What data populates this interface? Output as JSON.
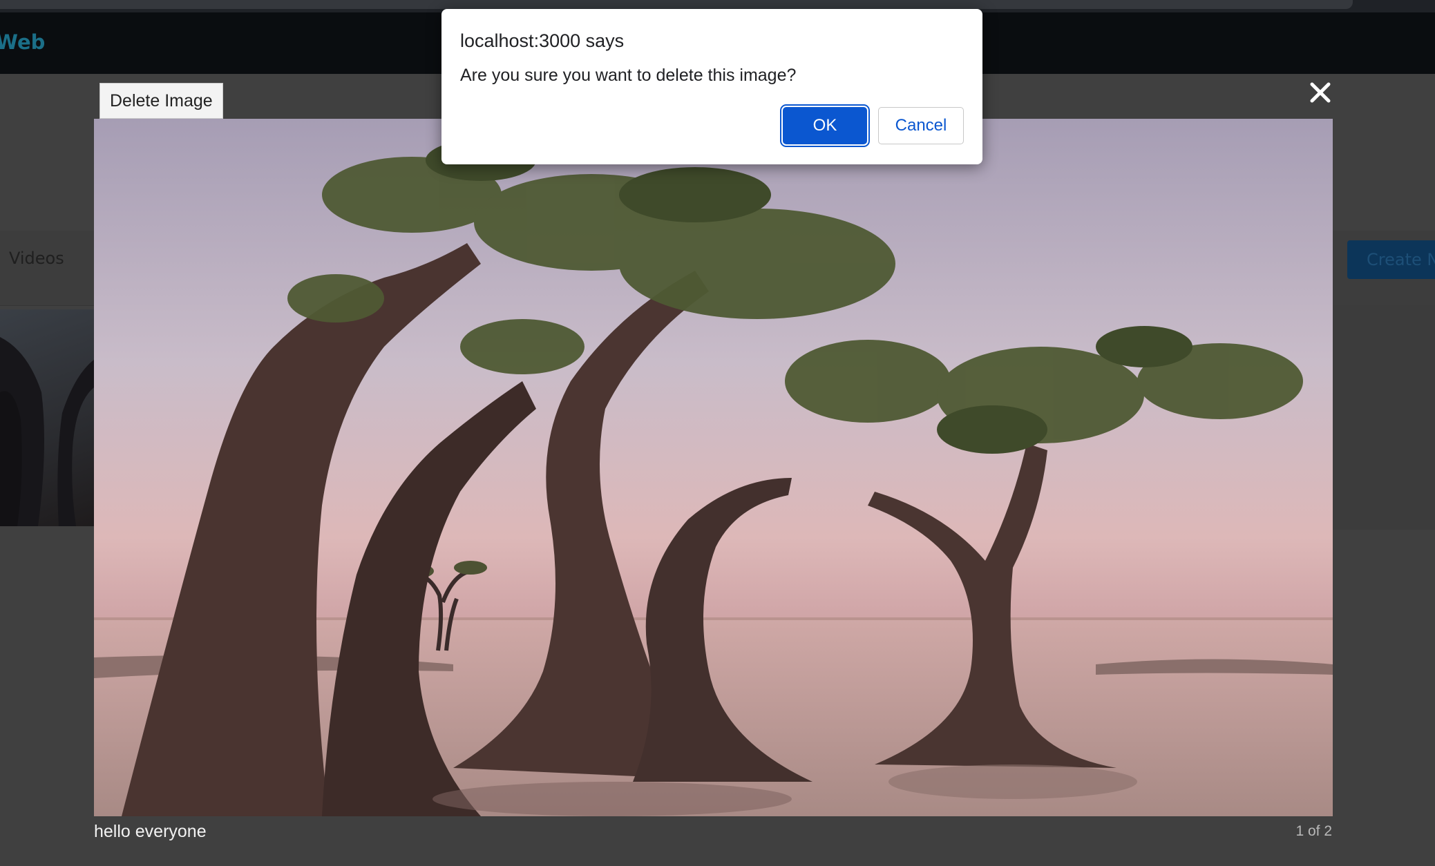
{
  "navbar": {
    "brand": "Web"
  },
  "subnav": {
    "videos_label": "Videos",
    "create_label": "Create Ne"
  },
  "lightbox": {
    "delete_label": "Delete Image",
    "caption": "hello everyone",
    "counter": "1 of 2",
    "close_icon": "close-icon"
  },
  "dialog": {
    "title": "localhost:3000 says",
    "message": "Are you sure you want to delete this image?",
    "ok_label": "OK",
    "cancel_label": "Cancel"
  },
  "colors": {
    "dialog_accent": "#0b57d0",
    "page_background": "#404040",
    "navbar": "#0a0d10"
  }
}
